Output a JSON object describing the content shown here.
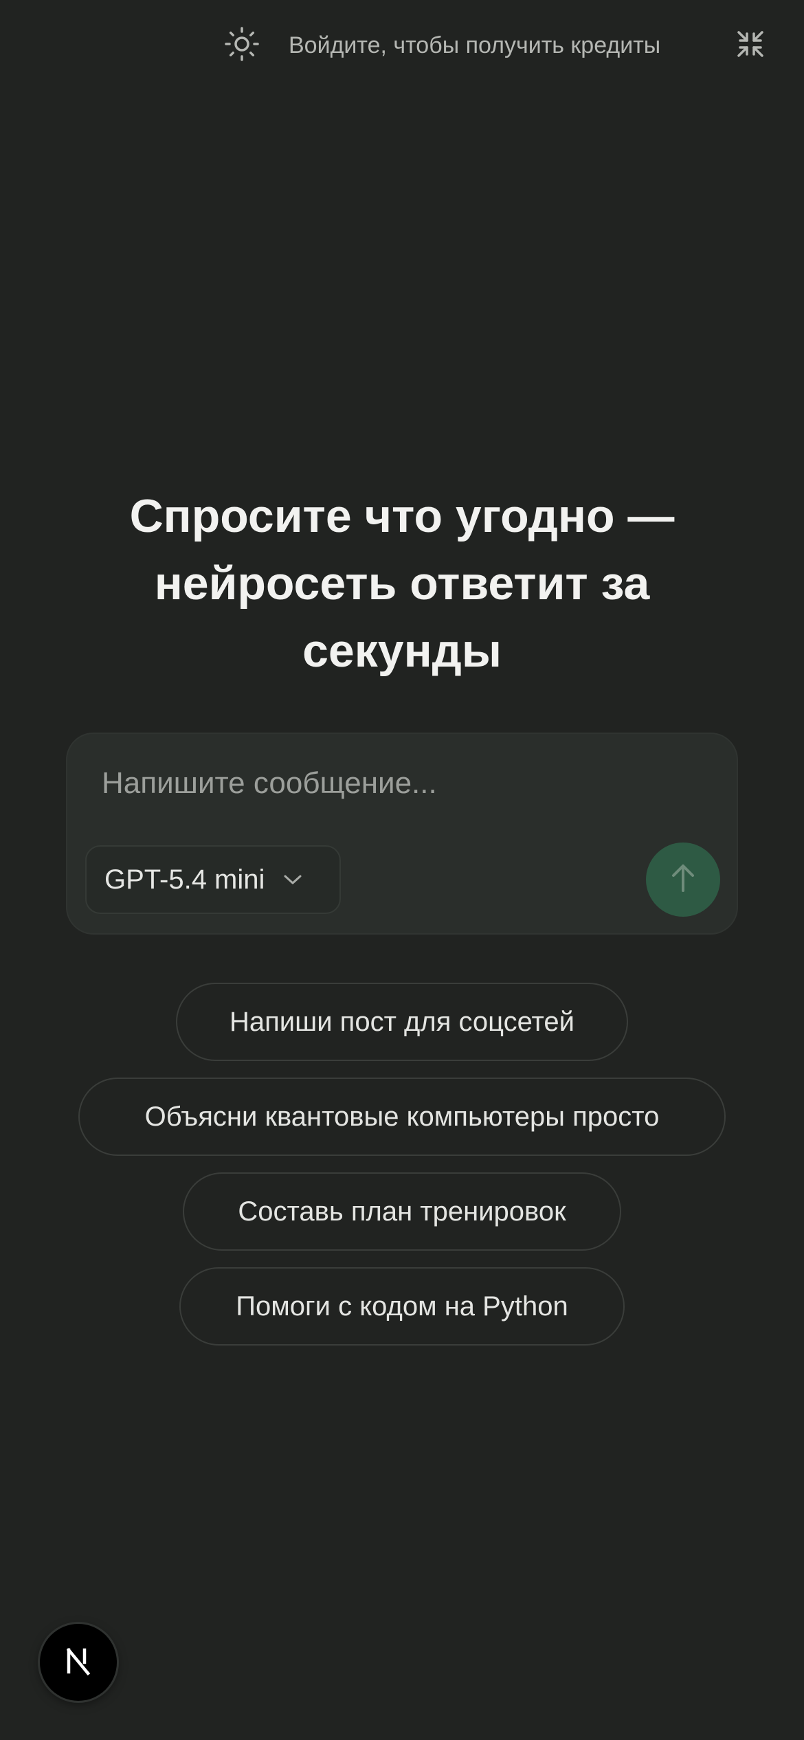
{
  "header": {
    "theme_icon": "sun-icon",
    "login_text": "Войдите, чтобы получить кредиты",
    "collapse_icon": "minimize-icon"
  },
  "hero": {
    "headline": "Спросите что угодно — нейросеть ответит за секунды"
  },
  "composer": {
    "placeholder": "Напишите сообщение...",
    "value": "",
    "model_label": "GPT-5.4 mini",
    "model_icon": "chevron-down-icon",
    "send_icon": "arrow-up-icon"
  },
  "suggestions": [
    {
      "label": "Напиши пост для соцсетей"
    },
    {
      "label": "Объясни квантовые компьютеры просто"
    },
    {
      "label": "Составь план тренировок"
    },
    {
      "label": "Помоги с кодом на Python"
    }
  ],
  "badge": {
    "icon": "next-logo-icon"
  },
  "colors": {
    "background": "#212321",
    "composer_bg": "#2a2e2b",
    "send_button": "#2e5a44",
    "muted_text": "#b5b7b3",
    "chip_border": "#3a3d3a"
  }
}
